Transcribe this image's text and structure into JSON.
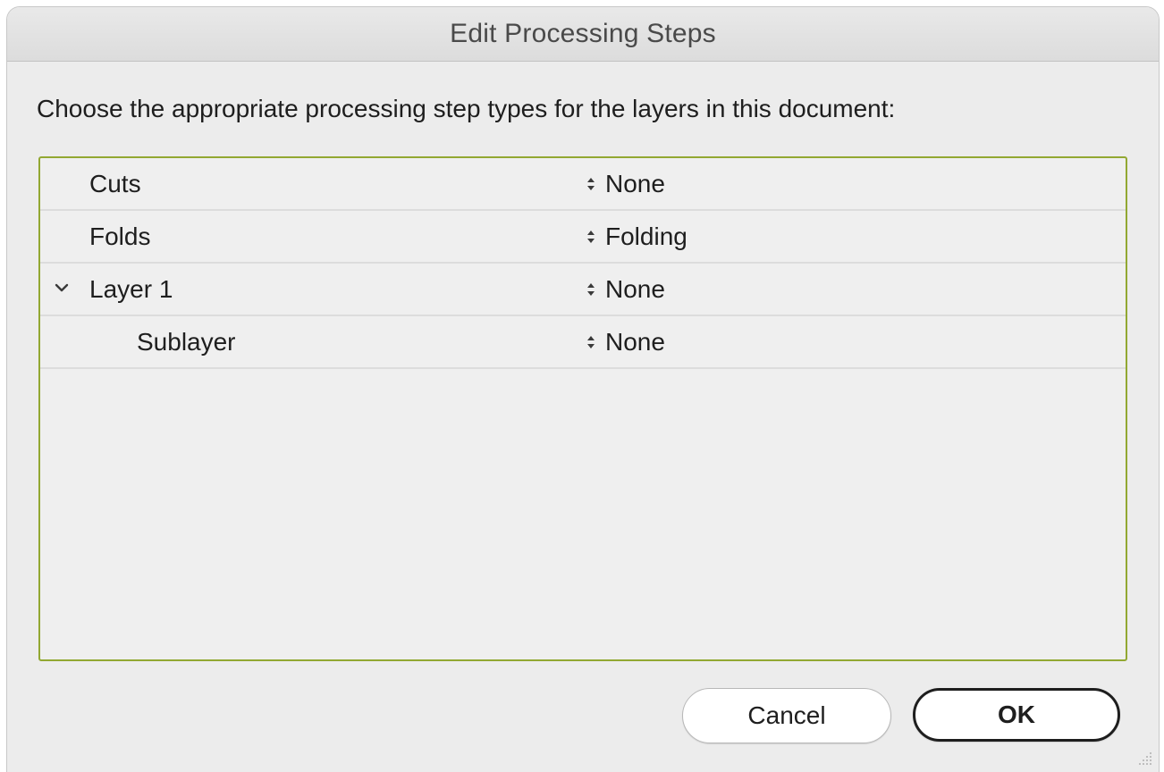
{
  "window": {
    "title": "Edit Processing Steps"
  },
  "instructions": "Choose the appropriate processing step types for the layers in this document:",
  "layers": [
    {
      "name": "Cuts",
      "step": "None",
      "level": 0,
      "expanded": null
    },
    {
      "name": "Folds",
      "step": "Folding",
      "level": 0,
      "expanded": null
    },
    {
      "name": "Layer 1",
      "step": "None",
      "level": 0,
      "expanded": true
    },
    {
      "name": "Sublayer",
      "step": "None",
      "level": 1,
      "expanded": null
    }
  ],
  "buttons": {
    "cancel_label": "Cancel",
    "ok_label": "OK"
  },
  "colors": {
    "focus_ring": "#92a832",
    "dialog_background": "#ececec"
  },
  "icons": {
    "disclosure": "chevron-down-icon",
    "step_selector": "up-down-arrows-icon",
    "resize": "resize-grip-icon"
  }
}
